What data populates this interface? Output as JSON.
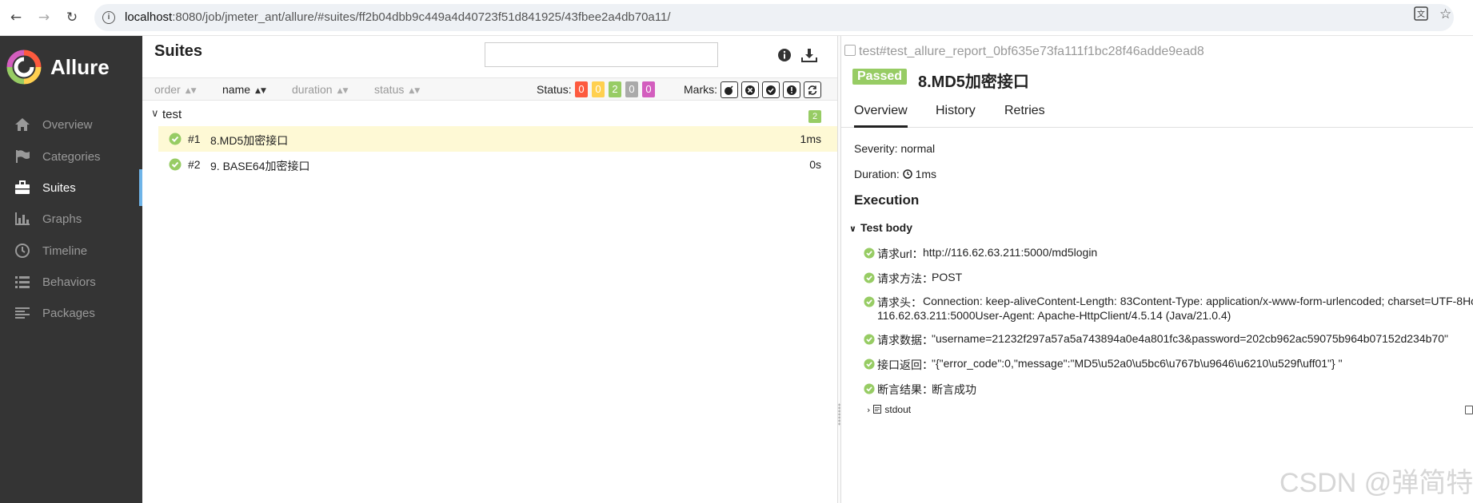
{
  "browser": {
    "url_host": "localhost",
    "url_rest": ":8080/job/jmeter_ant/allure/#suites/ff2b04dbb9c449a4d40723f51d841925/43fbee2a4db70a11/"
  },
  "sidebar": {
    "brand": "Allure",
    "items": [
      {
        "label": "Overview",
        "icon": "home-icon"
      },
      {
        "label": "Categories",
        "icon": "flag-icon"
      },
      {
        "label": "Suites",
        "icon": "briefcase-icon",
        "active": true
      },
      {
        "label": "Graphs",
        "icon": "bar-chart-icon"
      },
      {
        "label": "Timeline",
        "icon": "clock-icon"
      },
      {
        "label": "Behaviors",
        "icon": "list-icon"
      },
      {
        "label": "Packages",
        "icon": "align-left-icon"
      }
    ]
  },
  "suites": {
    "title": "Suites",
    "search_value": "",
    "columns": {
      "order": "order",
      "name": "name",
      "duration": "duration",
      "status": "status"
    },
    "status_label": "Status:",
    "status_counts": [
      {
        "value": "0",
        "color": "#fd5a3e"
      },
      {
        "value": "0",
        "color": "#ffd050"
      },
      {
        "value": "2",
        "color": "#97cc64"
      },
      {
        "value": "0",
        "color": "#aaaaaa"
      },
      {
        "value": "0",
        "color": "#d35ebe"
      }
    ],
    "marks_label": "Marks:",
    "group": {
      "name": "test",
      "count": "2"
    },
    "rows": [
      {
        "num": "#1",
        "name": "8.MD5加密接口",
        "duration": "1ms"
      },
      {
        "num": "#2",
        "name": "9. BASE64加密接口",
        "duration": "0s"
      }
    ]
  },
  "detail": {
    "breadcrumb": "test#test_allure_report_0bf635e73fa111f1bc28f46adde9ead8",
    "status": "Passed",
    "title": "8.MD5加密接口",
    "tabs": [
      "Overview",
      "History",
      "Retries"
    ],
    "severity_label": "Severity:",
    "severity_value": "normal",
    "duration_label": "Duration:",
    "duration_value": "1ms",
    "execution_title": "Execution",
    "test_body": "Test body",
    "steps": [
      {
        "label": "请求url：",
        "value": "http://116.62.63.211:5000/md5login"
      },
      {
        "label": "请求方法：",
        "value": "POST"
      },
      {
        "label": "请求头：",
        "value": "Connection: keep-aliveContent-Length: 83Content-Type: application/x-www-form-urlencoded; charset=UTF-8Ho",
        "value2": "116.62.63.211:5000User-Agent: Apache-HttpClient/4.5.14 (Java/21.0.4)"
      },
      {
        "label": "请求数据：",
        "value": "\"username=21232f297a57a5a743894a0e4a801fc3&password=202cb962ac59075b964b07152d234b70\""
      },
      {
        "label": "接口返回：",
        "value": "\"{\"error_code\":0,\"message\":\"MD5\\u52a0\\u5bc6\\u767b\\u9646\\u6210\\u529f\\uff01\"} \""
      },
      {
        "label": "断言结果：",
        "value": "断言成功"
      }
    ],
    "stdout": "stdout"
  },
  "watermark": "CSDN @弹简特"
}
